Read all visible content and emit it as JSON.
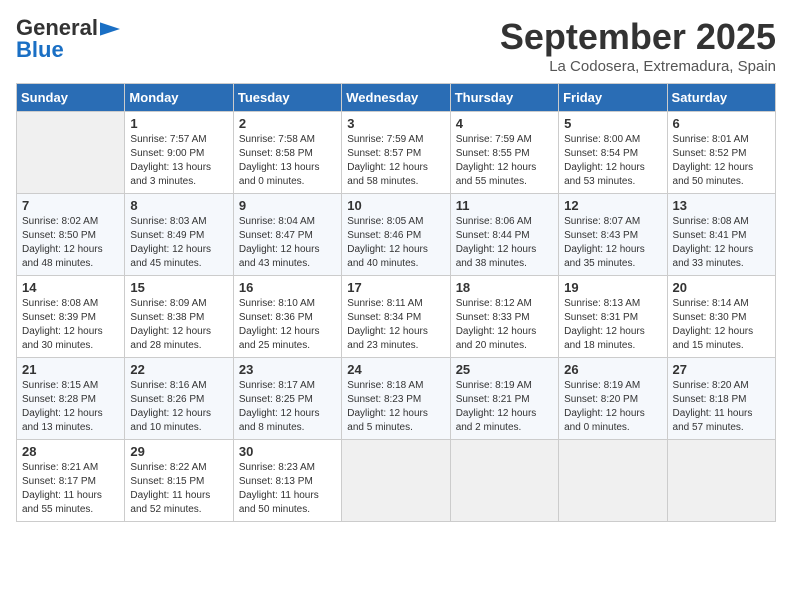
{
  "header": {
    "logo_line1": "General",
    "logo_line2": "Blue",
    "month": "September 2025",
    "location": "La Codosera, Extremadura, Spain"
  },
  "days_of_week": [
    "Sunday",
    "Monday",
    "Tuesday",
    "Wednesday",
    "Thursday",
    "Friday",
    "Saturday"
  ],
  "weeks": [
    [
      {
        "day": "",
        "info": ""
      },
      {
        "day": "1",
        "info": "Sunrise: 7:57 AM\nSunset: 9:00 PM\nDaylight: 13 hours\nand 3 minutes."
      },
      {
        "day": "2",
        "info": "Sunrise: 7:58 AM\nSunset: 8:58 PM\nDaylight: 13 hours\nand 0 minutes."
      },
      {
        "day": "3",
        "info": "Sunrise: 7:59 AM\nSunset: 8:57 PM\nDaylight: 12 hours\nand 58 minutes."
      },
      {
        "day": "4",
        "info": "Sunrise: 7:59 AM\nSunset: 8:55 PM\nDaylight: 12 hours\nand 55 minutes."
      },
      {
        "day": "5",
        "info": "Sunrise: 8:00 AM\nSunset: 8:54 PM\nDaylight: 12 hours\nand 53 minutes."
      },
      {
        "day": "6",
        "info": "Sunrise: 8:01 AM\nSunset: 8:52 PM\nDaylight: 12 hours\nand 50 minutes."
      }
    ],
    [
      {
        "day": "7",
        "info": "Sunrise: 8:02 AM\nSunset: 8:50 PM\nDaylight: 12 hours\nand 48 minutes."
      },
      {
        "day": "8",
        "info": "Sunrise: 8:03 AM\nSunset: 8:49 PM\nDaylight: 12 hours\nand 45 minutes."
      },
      {
        "day": "9",
        "info": "Sunrise: 8:04 AM\nSunset: 8:47 PM\nDaylight: 12 hours\nand 43 minutes."
      },
      {
        "day": "10",
        "info": "Sunrise: 8:05 AM\nSunset: 8:46 PM\nDaylight: 12 hours\nand 40 minutes."
      },
      {
        "day": "11",
        "info": "Sunrise: 8:06 AM\nSunset: 8:44 PM\nDaylight: 12 hours\nand 38 minutes."
      },
      {
        "day": "12",
        "info": "Sunrise: 8:07 AM\nSunset: 8:43 PM\nDaylight: 12 hours\nand 35 minutes."
      },
      {
        "day": "13",
        "info": "Sunrise: 8:08 AM\nSunset: 8:41 PM\nDaylight: 12 hours\nand 33 minutes."
      }
    ],
    [
      {
        "day": "14",
        "info": "Sunrise: 8:08 AM\nSunset: 8:39 PM\nDaylight: 12 hours\nand 30 minutes."
      },
      {
        "day": "15",
        "info": "Sunrise: 8:09 AM\nSunset: 8:38 PM\nDaylight: 12 hours\nand 28 minutes."
      },
      {
        "day": "16",
        "info": "Sunrise: 8:10 AM\nSunset: 8:36 PM\nDaylight: 12 hours\nand 25 minutes."
      },
      {
        "day": "17",
        "info": "Sunrise: 8:11 AM\nSunset: 8:34 PM\nDaylight: 12 hours\nand 23 minutes."
      },
      {
        "day": "18",
        "info": "Sunrise: 8:12 AM\nSunset: 8:33 PM\nDaylight: 12 hours\nand 20 minutes."
      },
      {
        "day": "19",
        "info": "Sunrise: 8:13 AM\nSunset: 8:31 PM\nDaylight: 12 hours\nand 18 minutes."
      },
      {
        "day": "20",
        "info": "Sunrise: 8:14 AM\nSunset: 8:30 PM\nDaylight: 12 hours\nand 15 minutes."
      }
    ],
    [
      {
        "day": "21",
        "info": "Sunrise: 8:15 AM\nSunset: 8:28 PM\nDaylight: 12 hours\nand 13 minutes."
      },
      {
        "day": "22",
        "info": "Sunrise: 8:16 AM\nSunset: 8:26 PM\nDaylight: 12 hours\nand 10 minutes."
      },
      {
        "day": "23",
        "info": "Sunrise: 8:17 AM\nSunset: 8:25 PM\nDaylight: 12 hours\nand 8 minutes."
      },
      {
        "day": "24",
        "info": "Sunrise: 8:18 AM\nSunset: 8:23 PM\nDaylight: 12 hours\nand 5 minutes."
      },
      {
        "day": "25",
        "info": "Sunrise: 8:19 AM\nSunset: 8:21 PM\nDaylight: 12 hours\nand 2 minutes."
      },
      {
        "day": "26",
        "info": "Sunrise: 8:19 AM\nSunset: 8:20 PM\nDaylight: 12 hours\nand 0 minutes."
      },
      {
        "day": "27",
        "info": "Sunrise: 8:20 AM\nSunset: 8:18 PM\nDaylight: 11 hours\nand 57 minutes."
      }
    ],
    [
      {
        "day": "28",
        "info": "Sunrise: 8:21 AM\nSunset: 8:17 PM\nDaylight: 11 hours\nand 55 minutes."
      },
      {
        "day": "29",
        "info": "Sunrise: 8:22 AM\nSunset: 8:15 PM\nDaylight: 11 hours\nand 52 minutes."
      },
      {
        "day": "30",
        "info": "Sunrise: 8:23 AM\nSunset: 8:13 PM\nDaylight: 11 hours\nand 50 minutes."
      },
      {
        "day": "",
        "info": ""
      },
      {
        "day": "",
        "info": ""
      },
      {
        "day": "",
        "info": ""
      },
      {
        "day": "",
        "info": ""
      }
    ]
  ]
}
